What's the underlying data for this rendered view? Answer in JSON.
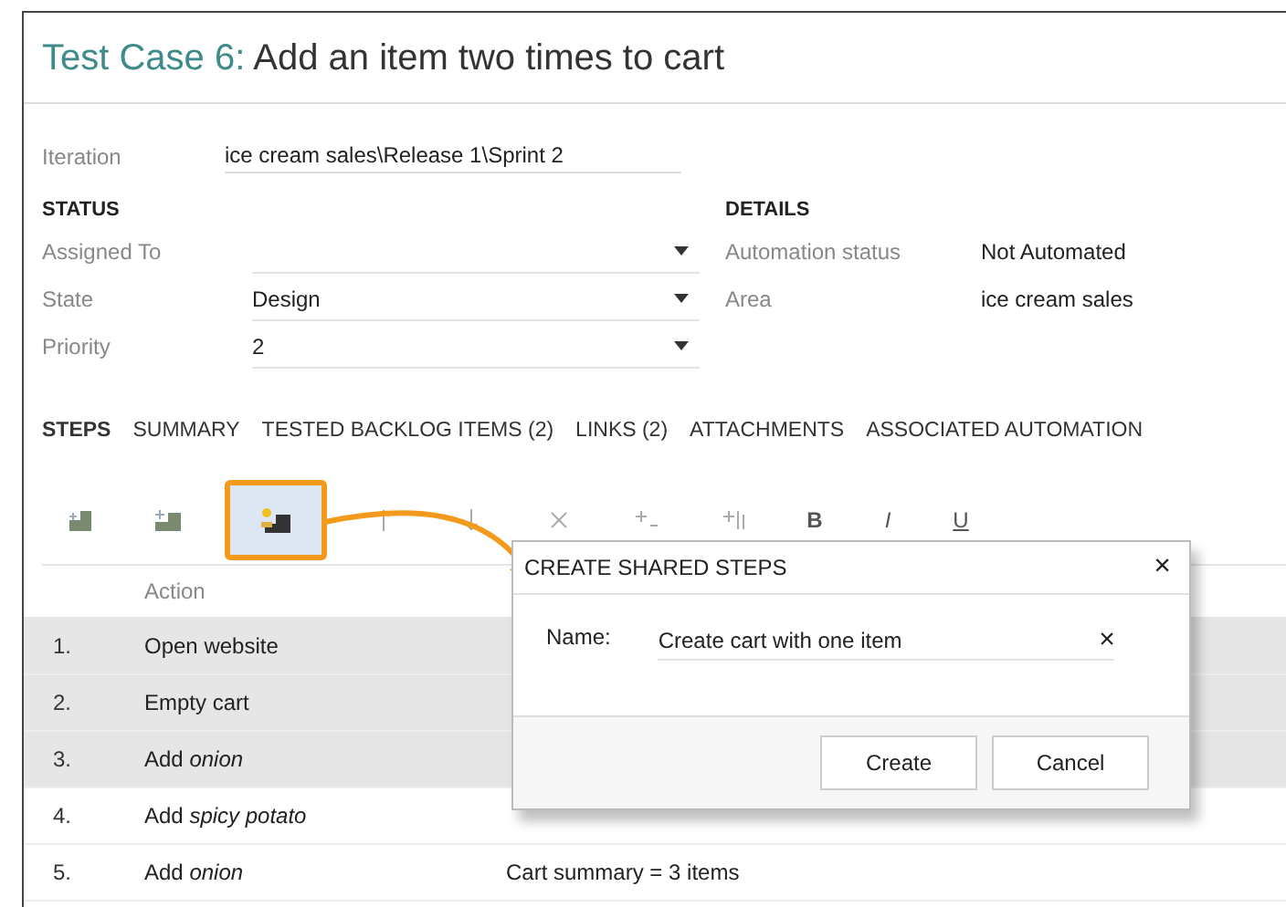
{
  "title": {
    "prefix": "Test Case 6:",
    "text": "Add an item two times to cart"
  },
  "iteration": {
    "label": "Iteration",
    "value": "ice cream sales\\Release 1\\Sprint 2"
  },
  "status": {
    "heading": "STATUS",
    "fields": [
      {
        "label": "Assigned To",
        "kind": "dropdown"
      },
      {
        "label": "State",
        "value": "Design",
        "kind": "dropdown"
      },
      {
        "label": "Priority",
        "value": "2",
        "kind": "dropdown"
      }
    ]
  },
  "details": {
    "heading": "DETAILS",
    "fields": [
      {
        "label": "Automation status",
        "value": "Not Automated"
      },
      {
        "label": "Area",
        "value": "ice cream sales"
      }
    ]
  },
  "tabs": [
    {
      "label": "STEPS",
      "selected": true
    },
    {
      "label": "SUMMARY",
      "selected": false
    },
    {
      "label": "TESTED BACKLOG ITEMS (2)",
      "selected": false
    },
    {
      "label": "LINKS (2)",
      "selected": false
    },
    {
      "label": "ATTACHMENTS",
      "selected": false
    },
    {
      "label": "ASSOCIATED AUTOMATION",
      "selected": false
    }
  ],
  "toolbar": {
    "icons": [
      {
        "kind": "insert-step",
        "selected": false
      },
      {
        "kind": "insert-shared",
        "selected": false
      },
      {
        "kind": "create-shared",
        "selected": true
      },
      {
        "kind": "up",
        "selected": false
      },
      {
        "kind": "down",
        "selected": false
      },
      {
        "kind": "delete",
        "selected": false
      },
      {
        "kind": "param",
        "selected": false
      },
      {
        "kind": "attach",
        "selected": false
      }
    ],
    "format": [
      "B",
      "I",
      "U"
    ]
  },
  "steps": {
    "column": "Action",
    "rows": [
      {
        "number": "1.",
        "action": "Open website",
        "selected": true
      },
      {
        "number": "2.",
        "action": "Empty cart",
        "selected": true
      },
      {
        "number": "3.",
        "action": "Add *onion*",
        "selected": true
      },
      {
        "number": "4.",
        "action": "Add *spicy potato*",
        "selected": false
      },
      {
        "number": "5.",
        "action": "Add *onion*",
        "selected": false,
        "expected": "Cart summary = 3 items"
      }
    ]
  },
  "dialog": {
    "title": "CREATE SHARED STEPS",
    "close": "×",
    "name_label": "Name:",
    "name_value": "Create cart with one item",
    "clear": "×",
    "buttons": [
      "Create",
      "Cancel"
    ]
  }
}
